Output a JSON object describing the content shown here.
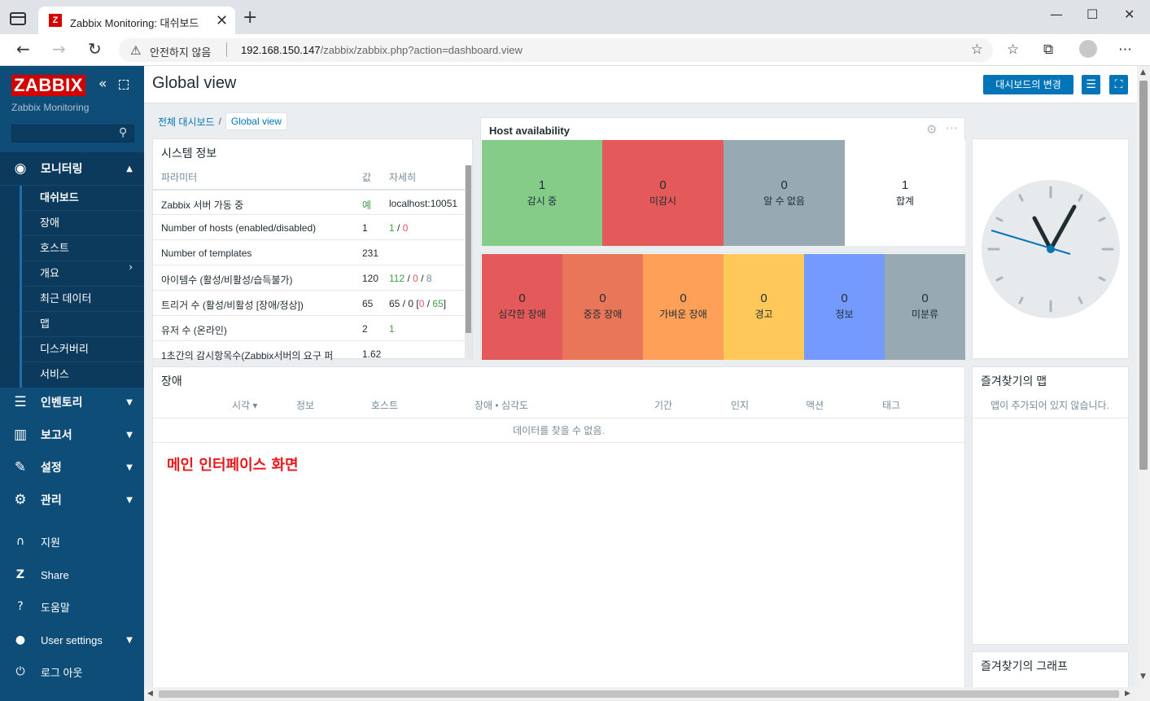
{
  "browser": {
    "tab_title": "Zabbix Monitoring: 대쉬보드",
    "tab_favicon": "Z",
    "tab_close": "✕",
    "new_tab": "+",
    "security_text": "안전하지 않음",
    "url_host": "192.168.150.147",
    "url_path": "/zabbix/zabbix.php?action=dashboard.view",
    "window_controls": [
      "—",
      "☐",
      "✕"
    ],
    "icons": [
      "tab-actions-icon",
      "back-icon",
      "forward-icon",
      "reload-icon",
      "warning-icon",
      "favorite-add-icon",
      "favorites-icon",
      "collections-icon",
      "profile-icon",
      "more-icon"
    ]
  },
  "sidebar": {
    "logo": "ZABBIX",
    "subtitle": "Zabbix Monitoring",
    "search_placeholder": "",
    "menu": [
      {
        "label": "모니터링",
        "icon": "eye-icon",
        "expanded": true
      },
      {
        "label": "인벤토리",
        "icon": "list-icon"
      },
      {
        "label": "보고서",
        "icon": "chart-icon"
      },
      {
        "label": "설정",
        "icon": "wrench-icon"
      },
      {
        "label": "관리",
        "icon": "gear-icon"
      }
    ],
    "submenu": [
      {
        "label": "대쉬보드",
        "active": true
      },
      {
        "label": "장애"
      },
      {
        "label": "호스트"
      },
      {
        "label": "개요",
        "has_children": true
      },
      {
        "label": "최근 데이터"
      },
      {
        "label": "맵"
      },
      {
        "label": "디스커버리"
      },
      {
        "label": "서비스"
      }
    ],
    "bottom": [
      {
        "label": "지원",
        "icon": "headset-icon"
      },
      {
        "label": "Share",
        "icon": "share-icon"
      },
      {
        "label": "도움말",
        "icon": "help-icon"
      },
      {
        "label": "User settings",
        "icon": "user-icon"
      },
      {
        "label": "로그 아웃",
        "icon": "power-icon"
      }
    ]
  },
  "header": {
    "title": "Global view",
    "change_button": "대시보드의 변경",
    "breadcrumb_root": "전체 대시보드",
    "breadcrumb_sep": "/",
    "breadcrumb_current": "Global view"
  },
  "system_info": {
    "title": "시스템 정보",
    "columns": [
      "파라미터",
      "값",
      "자세히"
    ],
    "rows": [
      {
        "param": "Zabbix 서버 가동 중",
        "value": "예",
        "detail": "localhost:10051"
      },
      {
        "param": "Number of hosts (enabled/disabled)",
        "value": "1",
        "detail_a": "1",
        "detail_sep": "/",
        "detail_b": "0"
      },
      {
        "param": "Number of templates",
        "value": "231"
      },
      {
        "param": "아이템수 (활성/비활성/습득불가)",
        "value": "120",
        "detail_a": "112",
        "detail_sep": "/",
        "detail_b": "0",
        "detail_sep2": "/",
        "detail_c": "8"
      },
      {
        "param": "트리거 수 (활성/비활성 [장애/정상])",
        "value": "65",
        "detail_a": "65 / 0 [",
        "detail_b": "0",
        "detail_sep": " / ",
        "detail_c": "65",
        "detail_end": "]"
      },
      {
        "param": "유저 수 (온라인)",
        "value": "2",
        "detail": "1"
      },
      {
        "param": "1초간의 감시항목수(Zabbix서버의 요구 퍼",
        "value": "1.62"
      }
    ]
  },
  "host_availability": {
    "title": "Host availability",
    "cells": [
      {
        "value": "1",
        "label": "감시 중",
        "color": "#86cc89"
      },
      {
        "value": "0",
        "label": "미감시",
        "color": "#e45959"
      },
      {
        "value": "0",
        "label": "알 수 없음",
        "color": "#97aab3"
      },
      {
        "value": "1",
        "label": "합계",
        "color": "#ffffff"
      }
    ]
  },
  "problems_by_severity": {
    "cells": [
      {
        "value": "0",
        "label": "심각한 장애",
        "color": "#e45959"
      },
      {
        "value": "0",
        "label": "중증 장애",
        "color": "#e97659"
      },
      {
        "value": "0",
        "label": "가벼운 장애",
        "color": "#ffa059"
      },
      {
        "value": "0",
        "label": "경고",
        "color": "#ffc859"
      },
      {
        "value": "0",
        "label": "정보",
        "color": "#7499ff"
      },
      {
        "value": "0",
        "label": "미분류",
        "color": "#97aab3"
      }
    ]
  },
  "problems": {
    "title": "장애",
    "columns": [
      "시각 ▾",
      "정보",
      "호스트",
      "장애 • 심각도",
      "기간",
      "인지",
      "액션",
      "태그"
    ],
    "empty_text": "데이터를 찾을 수 없음.",
    "annotation": "메인 인터페이스 화면"
  },
  "favorite_maps": {
    "title": "즐겨찾기의 맵",
    "empty_text": "맵이 추가되어 있지 않습니다."
  },
  "favorite_graphs": {
    "title": "즐겨찾기의 그래프"
  },
  "colors": {
    "sidebar": "#0f4d79",
    "accent": "#0275b8",
    "brand": "#d40000",
    "annotation": "#e8191d"
  }
}
